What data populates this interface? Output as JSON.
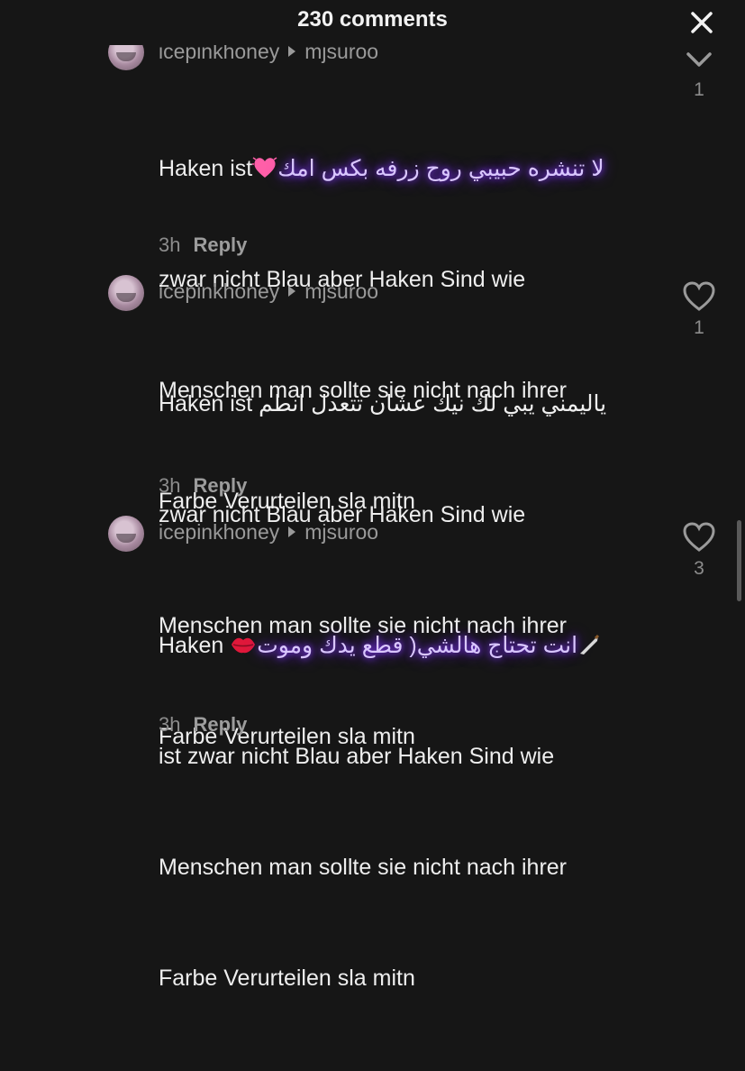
{
  "header": {
    "title": "230 comments"
  },
  "comments": [
    {
      "username": "icepinkhoney",
      "reply_to": "mjsuroo",
      "text_start": "Haken ist",
      "arabic": "لا تنشره حبيبي روح زرفه بكس امك",
      "lines": [
        "zwar nicht Blau aber Haken Sind wie",
        "Menschen man sollte sie nicht nach ihrer",
        "Farbe Verurteilen sla mitn"
      ],
      "time": "3h",
      "reply_label": "Reply",
      "likes": "1",
      "emoji": "heart-emoji"
    },
    {
      "username": "icepinkhoney",
      "reply_to": "mjsuroo",
      "text_start": "Haken ist",
      "arabic": "ياليمني يبي لك نيك عشان تتعدل انطم",
      "lines": [
        "zwar nicht Blau aber Haken Sind wie",
        "Menschen man sollte sie nicht nach ihrer",
        "Farbe Verurteilen sla mitn"
      ],
      "time": "3h",
      "reply_label": "Reply",
      "likes": "1"
    },
    {
      "username": "icepinkhoney",
      "reply_to": "mjsuroo",
      "text_start": "Haken",
      "arabic": "انت تحتاج هالشي( قطع يدك وموت",
      "lines": [
        "ist zwar nicht Blau aber Haken Sind wie",
        "Menschen man sollte sie nicht nach ihrer",
        "Farbe Verurteilen sla mitn"
      ],
      "time": "3h",
      "reply_label": "Reply",
      "likes": "3",
      "emoji": "lips-emoji"
    }
  ]
}
